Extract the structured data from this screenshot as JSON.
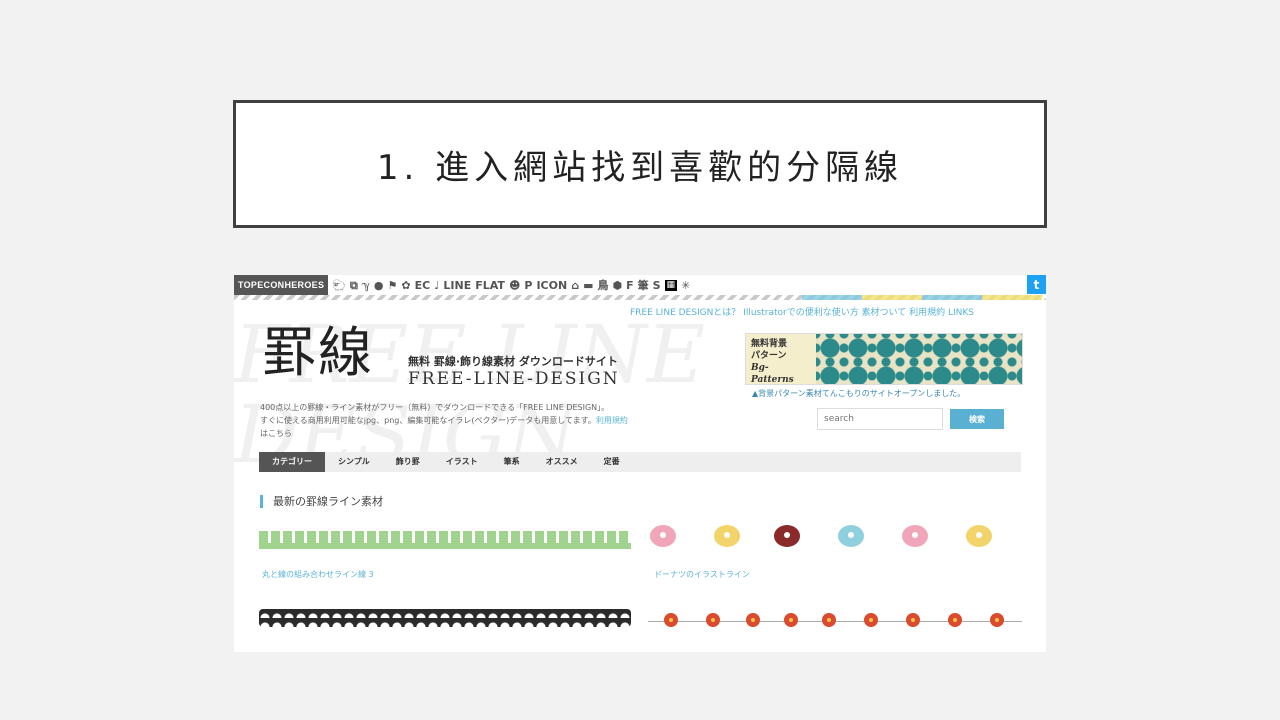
{
  "slide": {
    "title": "1. 進入網站找到喜歡的分隔線"
  },
  "topbar": {
    "brand": "TOPECONHEROES",
    "icons": [
      "🐑",
      "⧉",
      "ℽ",
      "●",
      "⚑",
      "✿",
      "EC",
      "♩",
      "LINE",
      "FLAT",
      "☻",
      "P",
      "ICON",
      "⌂",
      "▬",
      "鳥",
      "⬢",
      "F",
      "筆",
      "S",
      "▦",
      "✳"
    ],
    "twitter": "t"
  },
  "bg_decoration": "FREE LINE DESIGN",
  "header": {
    "topnav": "FREE LINE DESIGNとは？  Illustratorでの便利な使い方  素材ついて  利用規約  LINKS",
    "logo_kanji": "罫線",
    "logo_jp": "無料 罫線·飾り線素材 ダウンロードサイト",
    "logo_en": "FREE-LINE-DESIGN",
    "description_1": "400点以上の罫線・ライン素材がフリー（無料）でダウンロードできる「FREE LINE DESIGN」。",
    "description_2": "すぐに使える商用利用可能なjpg、png、編集可能なイラレ(ベクター)データも用意してます。",
    "description_link": "利用規約",
    "description_3": "はこちら"
  },
  "banner": {
    "line1": "無料背景",
    "line2": "パターン",
    "line3": "Bg-Patterns",
    "caption": "▲背景パターン素材てんこもりのサイトオープンしました。"
  },
  "search": {
    "placeholder": "search",
    "button": "検索"
  },
  "categories": [
    "カテゴリー",
    "シンプル",
    "飾り罫",
    "イラスト",
    "筆系",
    "オススメ",
    "定番"
  ],
  "section": {
    "title": "最新の罫線ライン素材"
  },
  "items": [
    {
      "caption": "丸と線の組み合わせライン線 3"
    },
    {
      "caption": "ドーナツのイラストライン"
    }
  ],
  "colors": {
    "accent": "#5ab3d6",
    "green_line": "#9fd38e",
    "donut_pink": "#f0a6b8",
    "donut_yellow": "#f2d46b",
    "donut_brown": "#8a2a2a",
    "donut_blue": "#8fd0df",
    "flower_red": "#d94a2e"
  }
}
